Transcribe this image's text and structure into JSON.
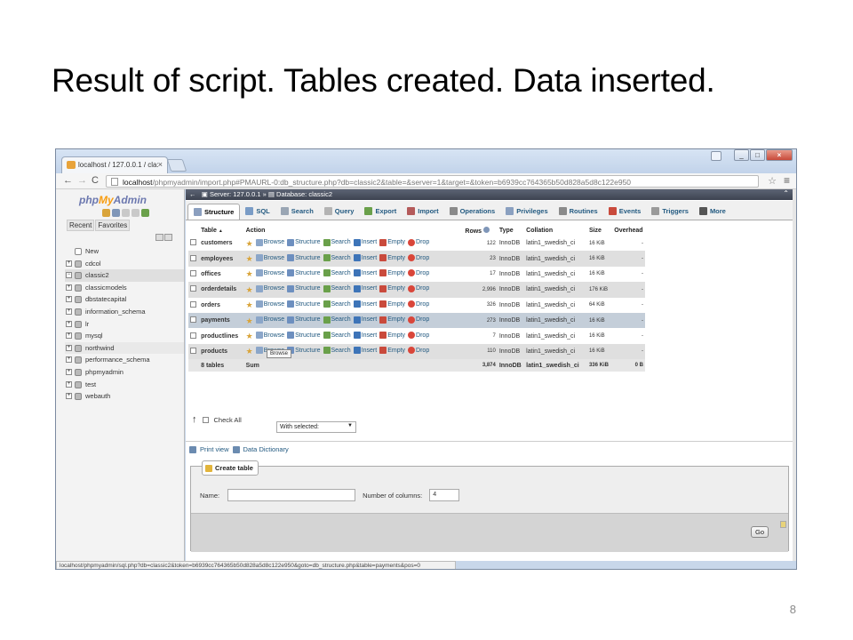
{
  "slide": {
    "title": "Result of script.  Tables created. Data inserted.",
    "page_number": "8"
  },
  "browser": {
    "tab_title": "localhost / 127.0.0.1 / cla:",
    "tab_close": "×",
    "nav_back": "←",
    "nav_forward": "→",
    "nav_reload": "C",
    "url_host": "localhost",
    "url_path": "/phpmyadmin/import.php#PMAURL-0:db_structure.php?db=classic2&table=&server=1&target=&token=b6939cc764365b50d828a5d8c122e950",
    "bookmark_icon": "star-icon",
    "menu_icon": "hamburger-menu-icon",
    "window_buttons": [
      "_",
      "□",
      "×"
    ],
    "status_url": "localhost/phpmyadmin/sql.php?db=classic2&token=b6939cc764365b50d828a5d8c122e950&goto=db_structure.php&table=payments&pos=0"
  },
  "left_panel": {
    "logo_php": "php",
    "logo_my": "My",
    "logo_admin": "Admin",
    "tab_recent": "Recent",
    "tab_favorites": "Favorites",
    "databases": [
      {
        "name": "New",
        "state": "new",
        "expander": ""
      },
      {
        "name": "cdcol",
        "state": "",
        "expander": "+"
      },
      {
        "name": "classic2",
        "state": "selected",
        "expander": "−"
      },
      {
        "name": "classicmodels",
        "state": "",
        "expander": "+"
      },
      {
        "name": "dbstatecapital",
        "state": "",
        "expander": "+"
      },
      {
        "name": "information_schema",
        "state": "",
        "expander": "+"
      },
      {
        "name": "lr",
        "state": "",
        "expander": "+"
      },
      {
        "name": "mysql",
        "state": "",
        "expander": "+"
      },
      {
        "name": "northwind",
        "state": "hover",
        "expander": "+"
      },
      {
        "name": "performance_schema",
        "state": "",
        "expander": "+"
      },
      {
        "name": "phpmyadmin",
        "state": "",
        "expander": "+"
      },
      {
        "name": "test",
        "state": "",
        "expander": "+"
      },
      {
        "name": "webauth",
        "state": "",
        "expander": "+"
      }
    ]
  },
  "breadcrumb": {
    "server": "Server: 127.0.0.1",
    "separator": "»",
    "database": "Database: classic2"
  },
  "top_menu": [
    {
      "label": "Structure",
      "active": true,
      "icon": "structure-icon",
      "color": "#8b9fbf"
    },
    {
      "label": "SQL",
      "active": false,
      "icon": "sql-icon",
      "color": "#7a9cc6"
    },
    {
      "label": "Search",
      "active": false,
      "icon": "search-icon",
      "color": "#9aa6b4"
    },
    {
      "label": "Query",
      "active": false,
      "icon": "query-icon",
      "color": "#b3b3b3"
    },
    {
      "label": "Export",
      "active": false,
      "icon": "export-icon",
      "color": "#6aa04a"
    },
    {
      "label": "Import",
      "active": false,
      "icon": "import-icon",
      "color": "#b45a5a"
    },
    {
      "label": "Operations",
      "active": false,
      "icon": "wrench-icon",
      "color": "#8a8a8a"
    },
    {
      "label": "Privileges",
      "active": false,
      "icon": "privileges-icon",
      "color": "#8aa0c0"
    },
    {
      "label": "Routines",
      "active": false,
      "icon": "routines-icon",
      "color": "#8a8a8a"
    },
    {
      "label": "Events",
      "active": false,
      "icon": "events-icon",
      "color": "#c94a3c"
    },
    {
      "label": "Triggers",
      "active": false,
      "icon": "triggers-icon",
      "color": "#9a9a9a"
    },
    {
      "label": "More",
      "active": false,
      "icon": "more-dropdown-icon",
      "color": "#555555"
    }
  ],
  "table_headers": {
    "table": "Table",
    "sort_arrow": "▲",
    "action": "Action",
    "rows": "Rows",
    "type": "Type",
    "collation": "Collation",
    "size": "Size",
    "overhead": "Overhead"
  },
  "actions": [
    "Browse",
    "Structure",
    "Search",
    "Insert",
    "Empty",
    "Drop"
  ],
  "tables": [
    {
      "name": "customers",
      "rows": "122",
      "type": "InnoDB",
      "collation": "latin1_swedish_ci",
      "size": "16 KiB",
      "overhead": "-",
      "style": "odd"
    },
    {
      "name": "employees",
      "rows": "23",
      "type": "InnoDB",
      "collation": "latin1_swedish_ci",
      "size": "16 KiB",
      "overhead": "-",
      "style": "even"
    },
    {
      "name": "offices",
      "rows": "17",
      "type": "InnoDB",
      "collation": "latin1_swedish_ci",
      "size": "16 KiB",
      "overhead": "-",
      "style": "odd"
    },
    {
      "name": "orderdetails",
      "rows": "2,996",
      "type": "InnoDB",
      "collation": "latin1_swedish_ci",
      "size": "176 KiB",
      "overhead": "-",
      "style": "even"
    },
    {
      "name": "orders",
      "rows": "326",
      "type": "InnoDB",
      "collation": "latin1_swedish_ci",
      "size": "64 KiB",
      "overhead": "-",
      "style": "odd"
    },
    {
      "name": "payments",
      "rows": "273",
      "type": "InnoDB",
      "collation": "latin1_swedish_ci",
      "size": "16 KiB",
      "overhead": "-",
      "style": "hl"
    },
    {
      "name": "productlines",
      "rows": "7",
      "type": "InnoDB",
      "collation": "latin1_swedish_ci",
      "size": "16 KiB",
      "overhead": "-",
      "style": "odd"
    },
    {
      "name": "products",
      "rows": "110",
      "type": "InnoDB",
      "collation": "latin1_swedish_ci",
      "size": "16 KiB",
      "overhead": "-",
      "style": "even"
    }
  ],
  "summary": {
    "count": "8 tables",
    "label": "Sum",
    "rows": "3,874",
    "type": "InnoDB",
    "collation": "latin1_swedish_ci",
    "size": "336 KiB",
    "overhead": "0 B"
  },
  "tooltip": "Browse",
  "bulk": {
    "check_all": "Check All",
    "with_selected": "With selected:",
    "dropdown_arrow": "▼"
  },
  "links": {
    "print_view": "Print view",
    "data_dictionary": "Data Dictionary"
  },
  "create_table": {
    "legend": "Create table",
    "name_label": "Name:",
    "name_value": "",
    "columns_label": "Number of columns:",
    "columns_value": "4",
    "go": "Go"
  }
}
